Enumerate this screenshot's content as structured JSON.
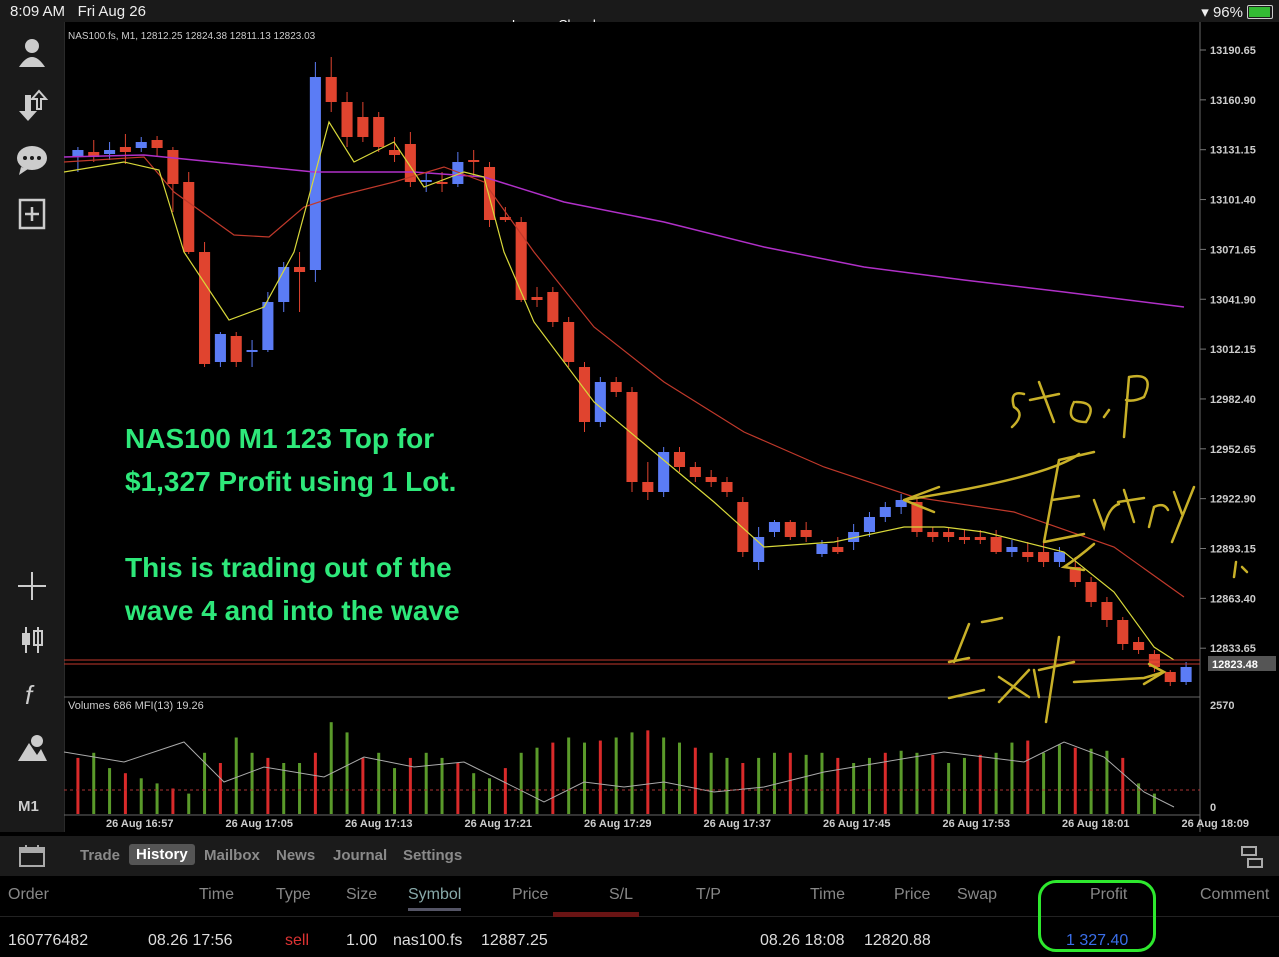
{
  "status": {
    "time": "8:09 AM",
    "date": "Fri Aug 26",
    "title": "Lennox Chambers",
    "battery": "96%",
    "battery_level": 96
  },
  "sidebar": {
    "timeframe": "M1"
  },
  "chart": {
    "info": "NAS100.fs, M1, 12812.25 12824.38 12811.13 12823.03",
    "price_labels": [
      "13190.65",
      "13160.90",
      "13131.15",
      "13101.40",
      "13071.65",
      "13041.90",
      "13012.15",
      "12982.40",
      "12952.65",
      "12922.90",
      "12893.15",
      "12863.40",
      "12833.65"
    ],
    "current_price": "12823.48",
    "volume_info": "Volumes 686 MFI(13) 19.26",
    "volume_labels": [
      "2570",
      "0"
    ],
    "time_labels": [
      "26 Aug 16:57",
      "26 Aug 17:05",
      "26 Aug 17:13",
      "26 Aug 17:21",
      "26 Aug 17:29",
      "26 Aug 17:37",
      "26 Aug 17:45",
      "26 Aug 17:53",
      "26 Aug 18:01",
      "26 Aug 18:09"
    ],
    "annotation_line1": "NAS100 M1 123 Top for",
    "annotation_line2": "$1,327 Profit using 1 Lot.",
    "annotation_line3": "This is trading out of the",
    "annotation_line4": "wave 4 and into the wave",
    "colors": {
      "bull": "#5b7cf5",
      "bear": "#e0442f",
      "ma_fast": "#d8d83a",
      "ma_mid": "#c0392b",
      "ma_slow": "#b030c8",
      "handwriting": "#c8b028",
      "vol_up": "#5a9a2a",
      "vol_down": "#d92a2a"
    }
  },
  "tabs": [
    "Trade",
    "History",
    "Mailbox",
    "News",
    "Journal",
    "Settings"
  ],
  "table": {
    "headers": [
      "Order",
      "Time",
      "Type",
      "Size",
      "Symbol",
      "Price",
      "S/L",
      "T/P",
      "Time",
      "Price",
      "Swap",
      "Profit",
      "Comment"
    ],
    "row": {
      "order": "160776482",
      "open_time": "08.26 17:56",
      "type": "sell",
      "size": "1.00",
      "symbol": "nas100.fs",
      "open_price": "12887.25",
      "close_time": "08.26 18:08",
      "close_price": "12820.88",
      "profit": "1 327.40"
    }
  }
}
